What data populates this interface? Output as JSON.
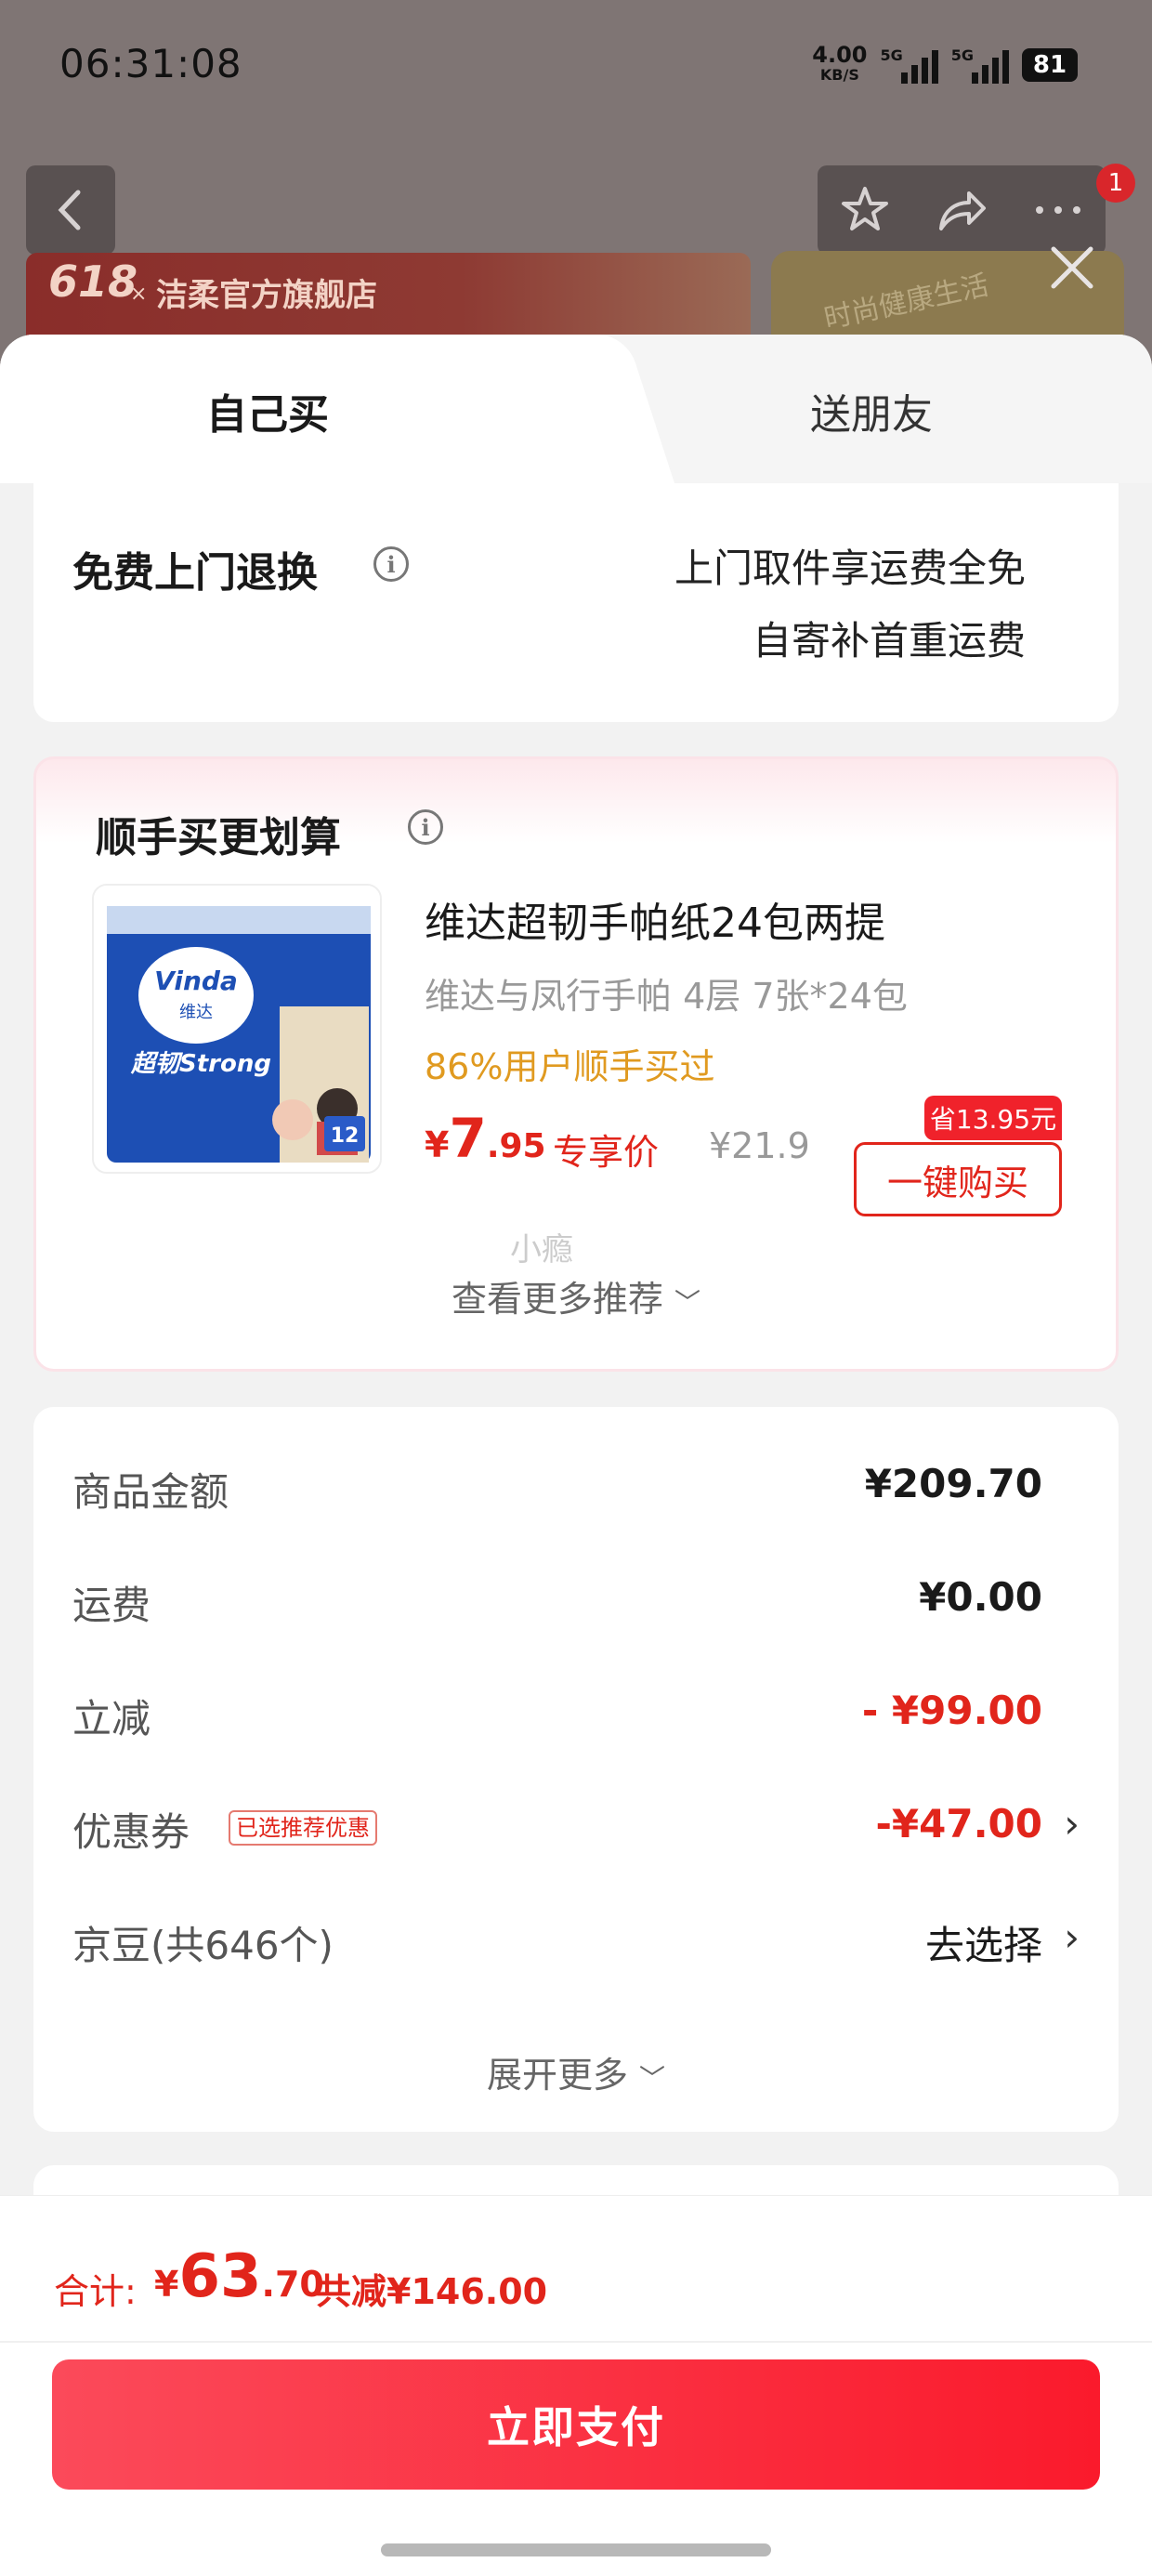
{
  "status_bar": {
    "time": "06:31:08",
    "net_speed": "4.00",
    "net_unit": "KB/S",
    "signal_1_label": "5G",
    "signal_2_label": "5G",
    "battery": "81"
  },
  "background_page": {
    "store_badge": "618",
    "store_x": "×",
    "store_name": "洁柔官方旗舰店",
    "banner_text": "时尚健康生活",
    "cart_badge": "1"
  },
  "tabs": [
    {
      "label": "自己买",
      "active": true
    },
    {
      "label": "送朋友",
      "active": false
    }
  ],
  "return_service": {
    "title": "免费上门退换",
    "line1": "上门取件享运费全免",
    "line2": "自寄补首重运费"
  },
  "bundle": {
    "title": "顺手买更划算",
    "product": {
      "name": "维达超韧手帕纸24包两提",
      "spec": "维达与凤行手帕 4层 7张*24包",
      "popularity": "86%用户顺手买过",
      "price_currency": "¥",
      "price_int": "7",
      "price_dec": ".95",
      "price_label": "专享价",
      "original_price": "¥21.9",
      "save_tag": "省13.95元",
      "buy_button": "一键购买",
      "image_brand": "Vinda",
      "image_brand_cn": "维达",
      "image_line": "超韧Strong",
      "image_count": "12"
    },
    "watermark": "小瘾",
    "more_label": "查看更多推荐"
  },
  "summary": {
    "rows": [
      {
        "label": "商品金额",
        "value": "¥209.70"
      },
      {
        "label": "运费",
        "value": "¥0.00"
      },
      {
        "label": "立减",
        "value": "- ¥99.00"
      },
      {
        "label": "优惠券",
        "tag": "已选推荐优惠",
        "value": "-¥47.00"
      },
      {
        "label": "京豆(共646个)",
        "value": "去选择"
      }
    ],
    "expand_label": "展开更多"
  },
  "footer": {
    "total_label": "合计:",
    "total_currency": "¥",
    "total_int": "63",
    "total_dec": ".70",
    "total_save": "共减¥146.00",
    "pay_button": "立即支付"
  },
  "colors": {
    "accent_red": "#e1251b",
    "pay_gradient_start": "#fb4a5a",
    "pay_gradient_end": "#fa1a2c",
    "popularity_orange": "#e09a20"
  }
}
